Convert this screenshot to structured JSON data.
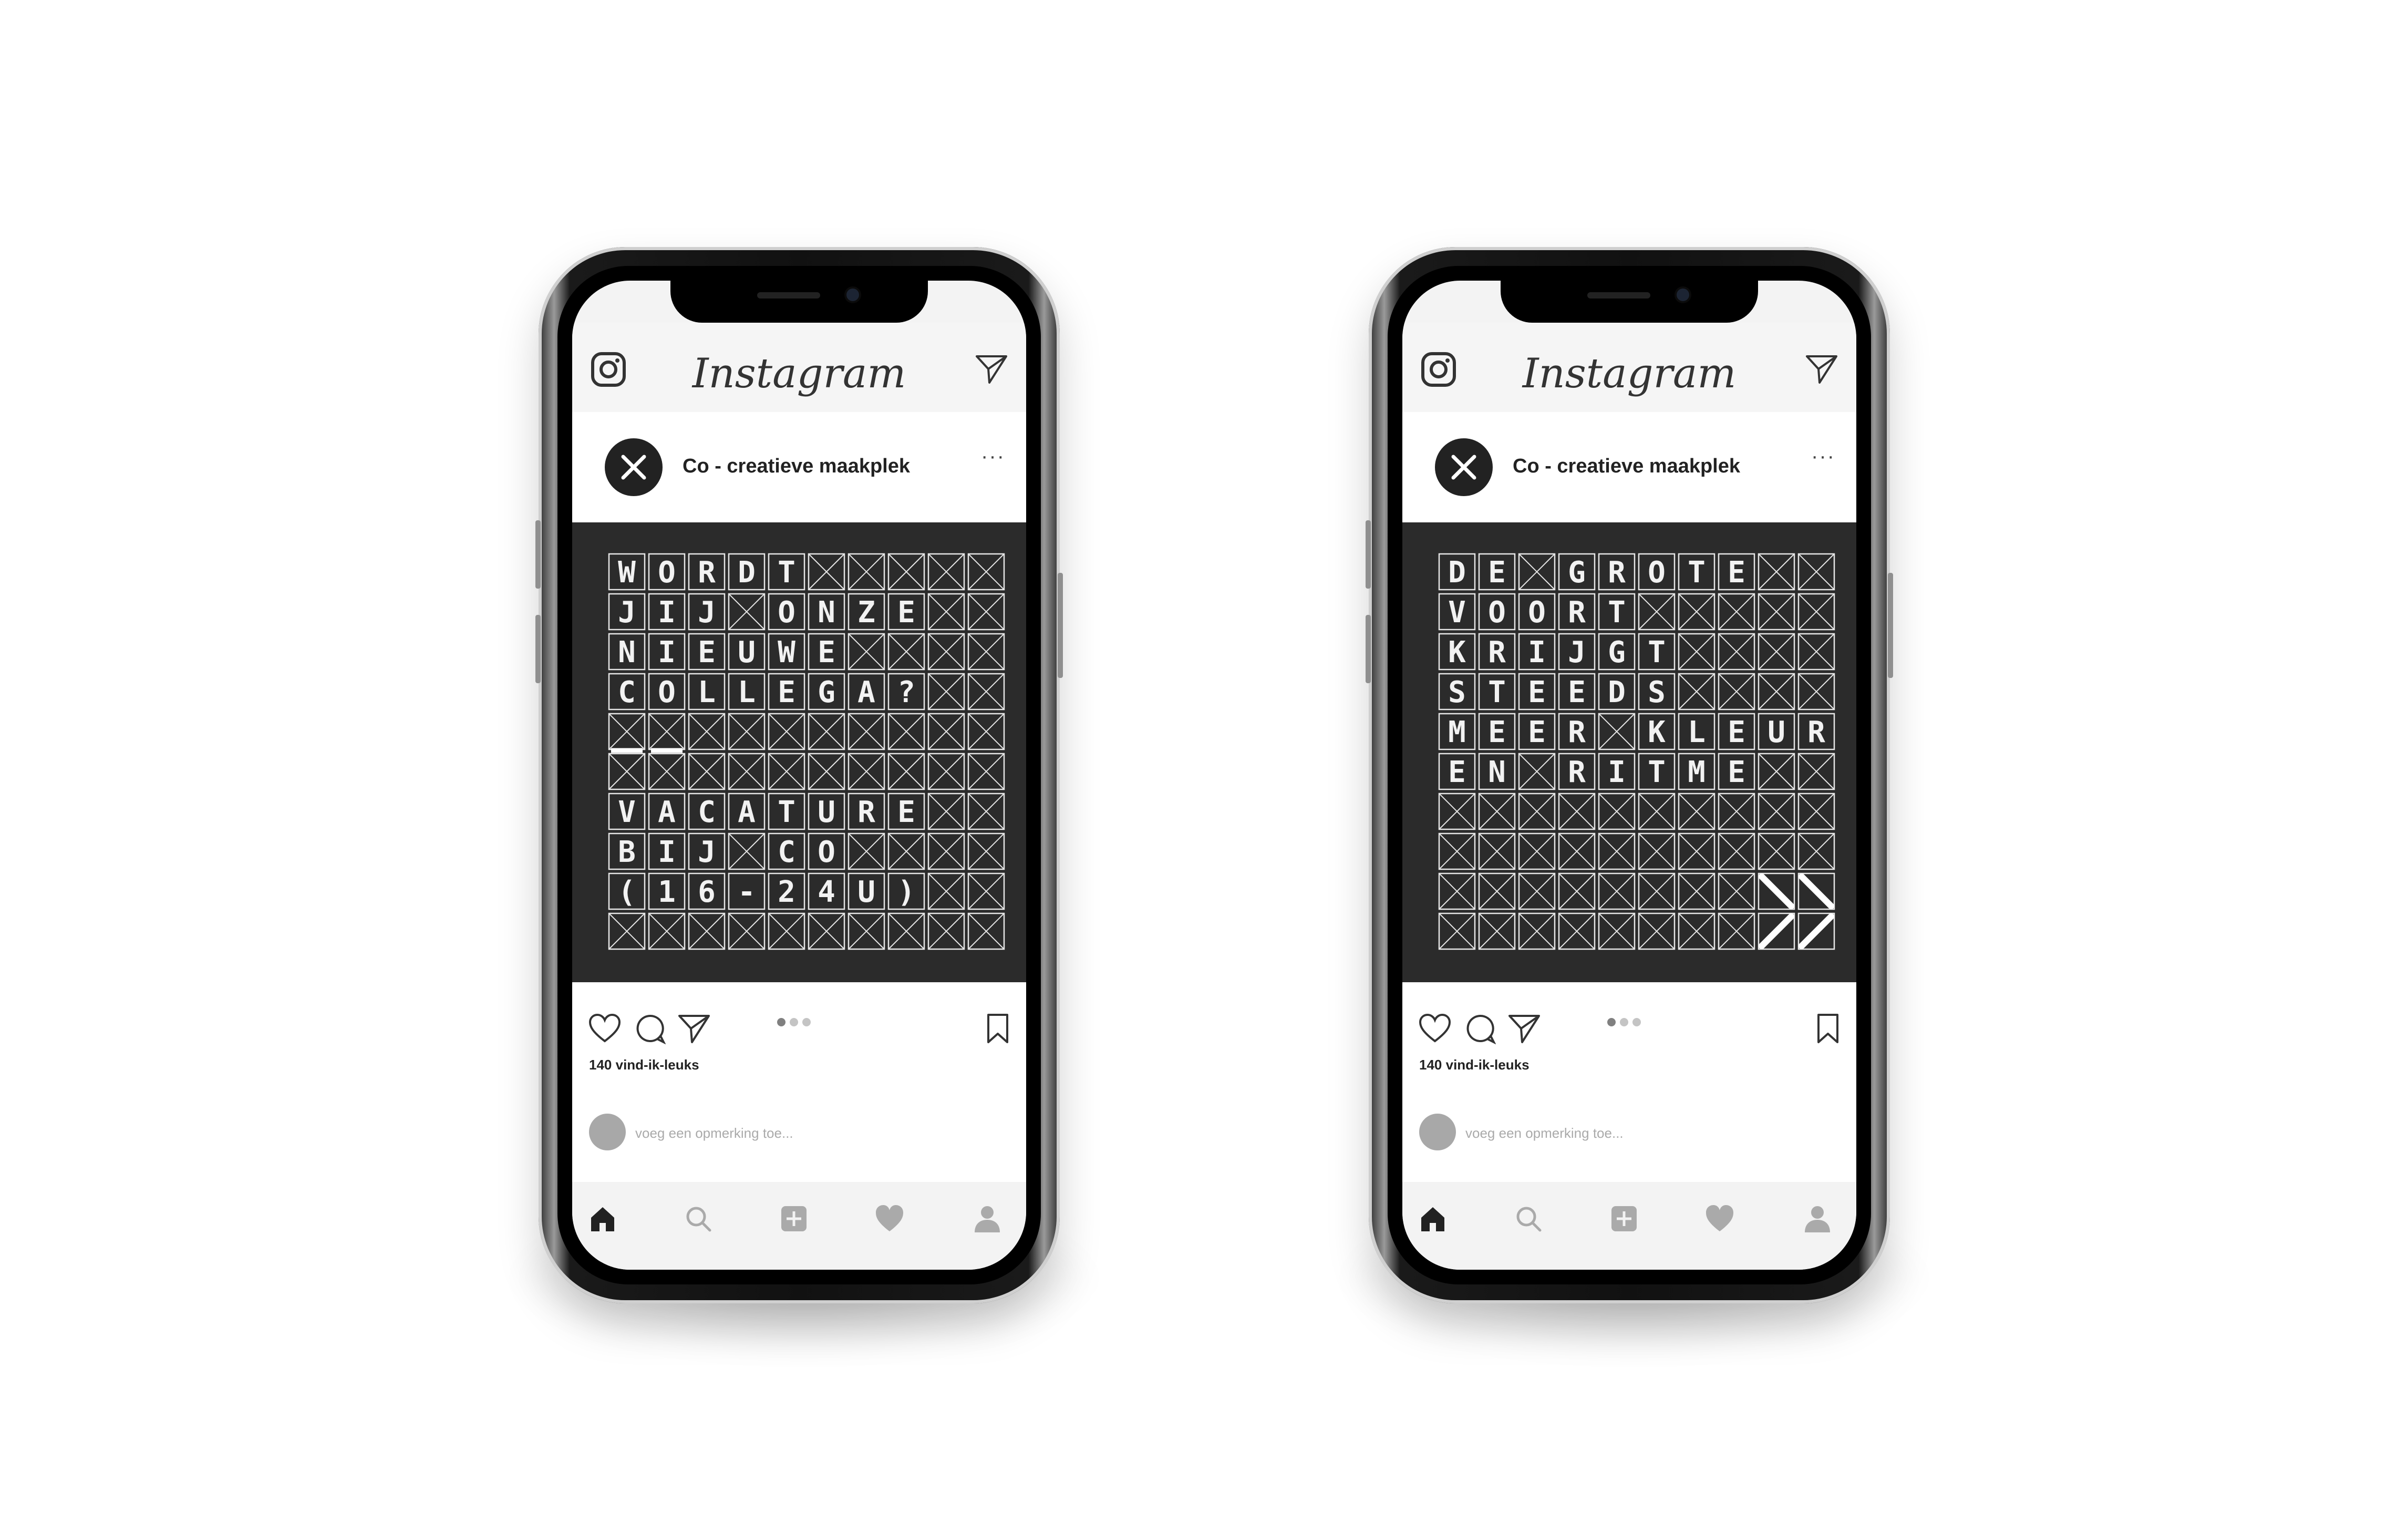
{
  "phones": [
    {
      "app_title": "Instagram",
      "account": "Co - creatieve maakplek",
      "more_label": "···",
      "likes": "140 vind-ik-leuks",
      "comment_placeholder": "voeg een opmerking toe...",
      "carousel": {
        "count": 3,
        "active": 0
      },
      "grid_rows": [
        "WORDT",
        "JIJ ONZE",
        "NIEUWE",
        "COLLEGA?",
        "",
        "",
        "VACATURE",
        "BIJ CO",
        "(16-24U)",
        ""
      ],
      "underscores": [
        [
          4,
          0
        ],
        [
          4,
          1
        ]
      ],
      "bold_marks": []
    },
    {
      "app_title": "Instagram",
      "account": "Co - creatieve maakplek",
      "more_label": "···",
      "likes": "140 vind-ik-leuks",
      "comment_placeholder": "voeg een opmerking toe...",
      "carousel": {
        "count": 3,
        "active": 0
      },
      "grid_rows": [
        "DE GROTE",
        "VOORT",
        "KRIJGT",
        "STEEDS",
        "MEER KLEUR",
        "EN RITME",
        "",
        "",
        "",
        ""
      ],
      "underscores": [],
      "bold_marks": [
        {
          "row": 8,
          "col": 8,
          "dir": "\\"
        },
        {
          "row": 8,
          "col": 9,
          "dir": "\\"
        },
        {
          "row": 9,
          "col": 8,
          "dir": "/"
        },
        {
          "row": 9,
          "col": 9,
          "dir": "/"
        }
      ]
    }
  ],
  "icons": [
    "instagram-camera-icon",
    "direct-message-icon",
    "heart-icon",
    "comment-icon",
    "share-icon",
    "bookmark-icon",
    "home-icon",
    "search-icon",
    "add-icon",
    "activity-icon",
    "profile-icon"
  ],
  "colors": {
    "post_background": "#2b2b2b",
    "grid_line": "#e6e6e6",
    "letters": "#f2f2f2"
  }
}
